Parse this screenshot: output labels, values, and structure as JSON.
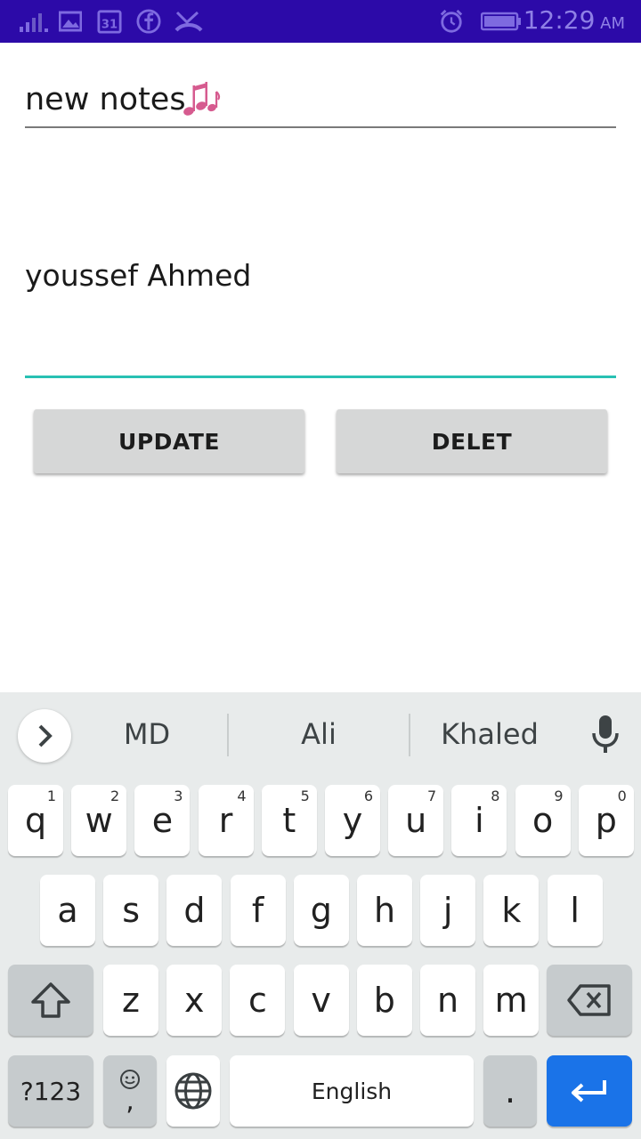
{
  "status_bar": {
    "time": "12:29",
    "ampm": "AM",
    "calendar_day": "31",
    "icons": [
      "signal-icon",
      "gallery-icon",
      "calendar-icon",
      "facebook-icon",
      "missed-call-icon",
      "alarm-icon",
      "battery-icon"
    ]
  },
  "note": {
    "title": "new notes",
    "title_icon": "music-notes-icon",
    "body": "youssef Ahmed"
  },
  "buttons": {
    "update": "UPDATE",
    "delete": "DELET"
  },
  "keyboard": {
    "suggestions": [
      "MD",
      "Ali",
      "Khaled"
    ],
    "row1": [
      {
        "k": "q",
        "n": "1"
      },
      {
        "k": "w",
        "n": "2"
      },
      {
        "k": "e",
        "n": "3"
      },
      {
        "k": "r",
        "n": "4"
      },
      {
        "k": "t",
        "n": "5"
      },
      {
        "k": "y",
        "n": "6"
      },
      {
        "k": "u",
        "n": "7"
      },
      {
        "k": "i",
        "n": "8"
      },
      {
        "k": "o",
        "n": "9"
      },
      {
        "k": "p",
        "n": "0"
      }
    ],
    "row2": [
      "a",
      "s",
      "d",
      "f",
      "g",
      "h",
      "j",
      "k",
      "l"
    ],
    "row3": [
      "z",
      "x",
      "c",
      "v",
      "b",
      "n",
      "m"
    ],
    "symbols_label": "?123",
    "comma": ",",
    "space_label": "English",
    "period": ".",
    "colors": {
      "accent_underline": "#28c1b3",
      "enter": "#1a73e8",
      "status_bar": "#2c0aa8"
    }
  }
}
